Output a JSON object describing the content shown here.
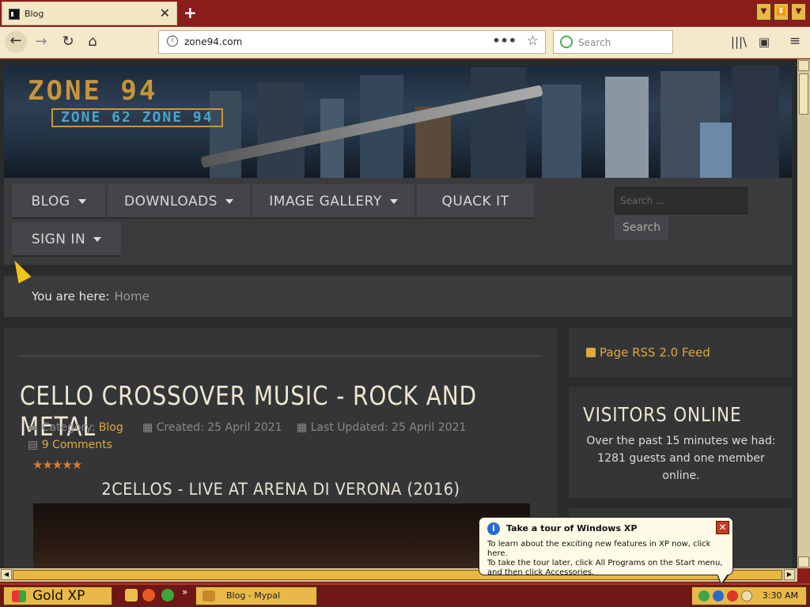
{
  "browser": {
    "tab_title": "Blog",
    "new_tab_icon": "+",
    "url": "zone94.com",
    "search_placeholder": "Search"
  },
  "site": {
    "logo_main": "ZONE 94",
    "logo_sub": "ZONE 62 ZONE 94",
    "menu": [
      {
        "label": "BLOG",
        "has_dropdown": true
      },
      {
        "label": "DOWNLOADS",
        "has_dropdown": true
      },
      {
        "label": "IMAGE GALLERY",
        "has_dropdown": true
      },
      {
        "label": "QUACK IT",
        "has_dropdown": false
      },
      {
        "label": "SIGN IN",
        "has_dropdown": true
      }
    ],
    "search_placeholder": "Search ...",
    "search_button": "Search",
    "breadcrumb_label": "You are here:",
    "breadcrumb_current": "Home"
  },
  "article": {
    "title": "CELLO CROSSOVER MUSIC - ROCK AND METAL",
    "category_label": "Category:",
    "category_value": "Blog",
    "created": "Created: 25 April 2021",
    "updated": "Last Updated: 25 April 2021",
    "comments": "9 Comments",
    "rating_stars": 5,
    "video_title": "2CELLOS - LIVE AT ARENA DI VERONA (2016)"
  },
  "sidebar": {
    "rss": "Page RSS 2.0 Feed",
    "visitors_title": "VISITORS ONLINE",
    "visitors_text": "Over the past 15 minutes we had: 1281 guests and one member online."
  },
  "balloon": {
    "title": "Take a tour of Windows XP",
    "line1": "To learn about the exciting new features in XP now, click here.",
    "line2": "To take the tour later, click All Programs on the Start menu,",
    "line3": "and then click Accessories."
  },
  "taskbar": {
    "start_label": "Gold XP",
    "task_label": "Blog - Mypal",
    "clock": "3:30 AM",
    "more_icon": "»"
  },
  "colors": {
    "accent": "#e0a93a",
    "frame": "#8b1c1c",
    "page_bg": "#2a2b2d"
  }
}
